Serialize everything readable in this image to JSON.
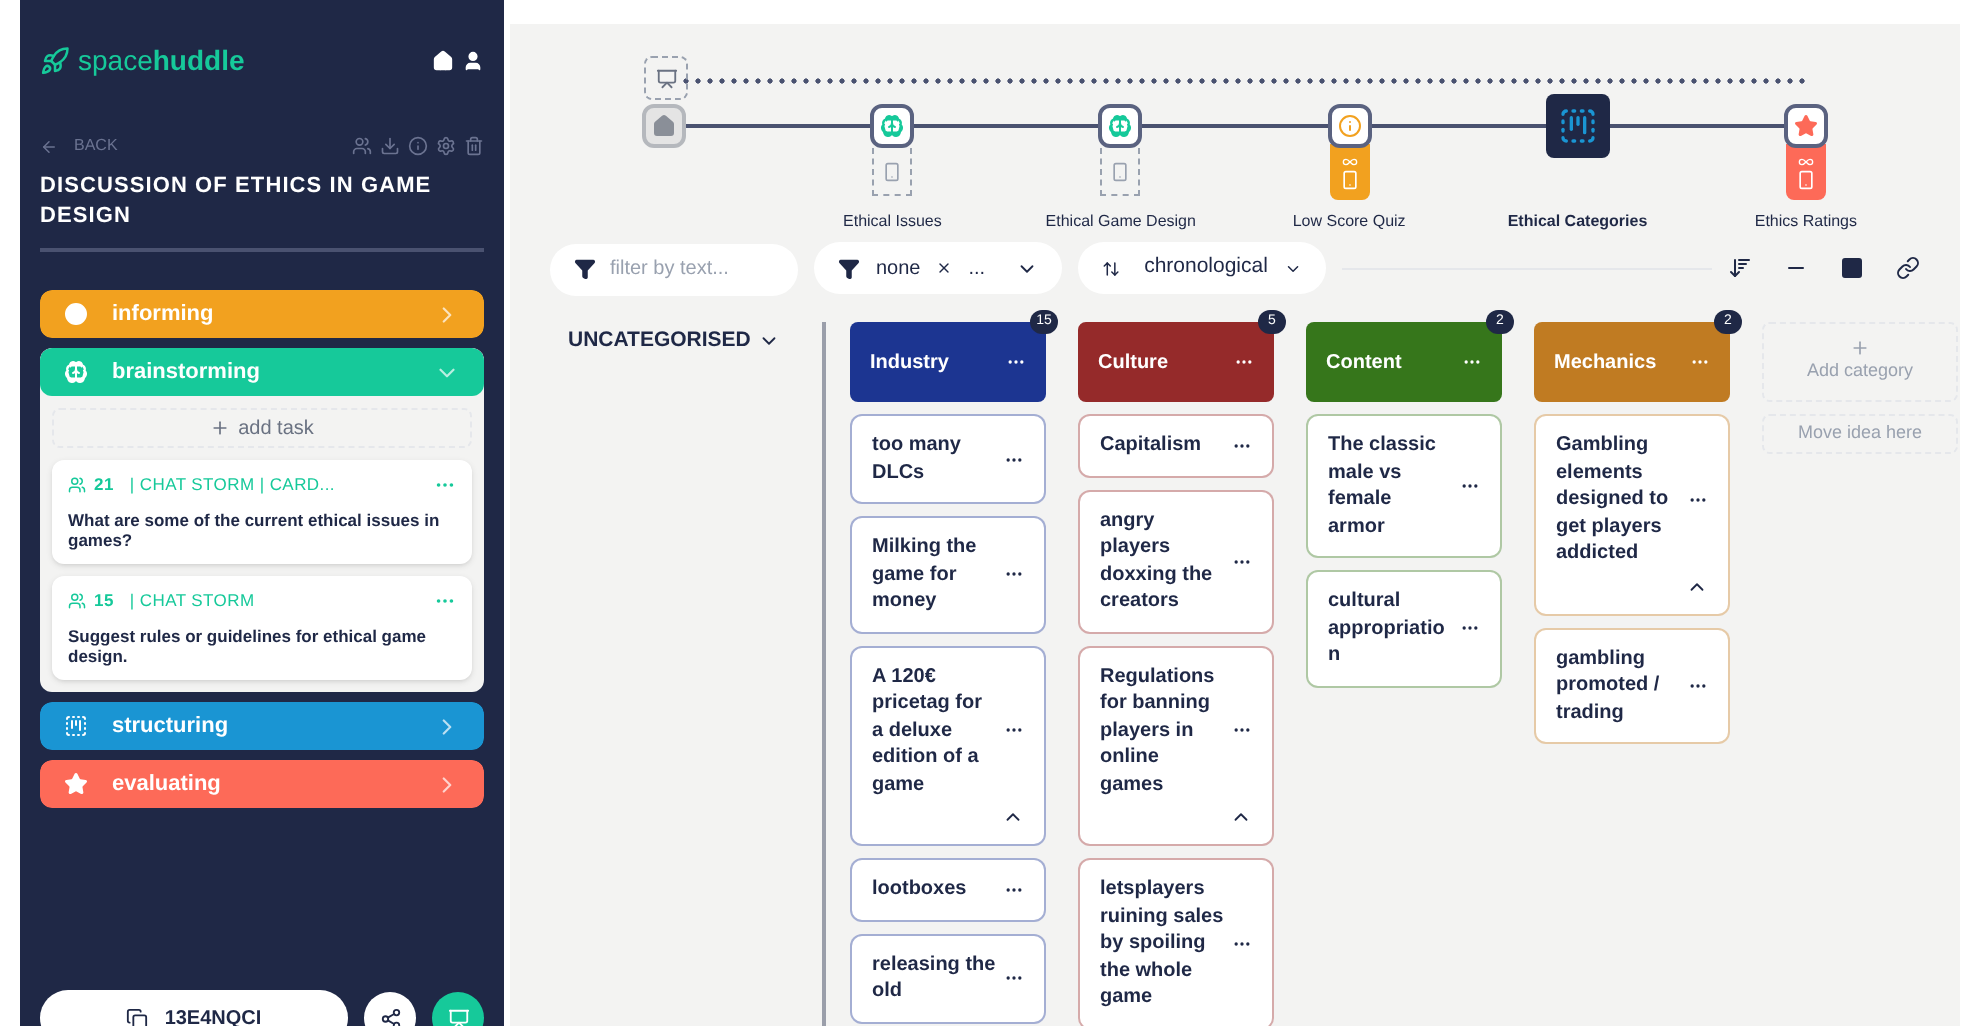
{
  "sidebar": {
    "logo": {
      "light": "space",
      "bold": "huddle"
    },
    "back": "BACK",
    "session_title": "DISCUSSION OF ETHICS IN GAME DESIGN",
    "phases": [
      {
        "kind": "info",
        "label": "informing",
        "color": "#f2a11f",
        "expanded": false
      },
      {
        "kind": "brainstorm",
        "label": "brainstorming",
        "color": "#16c99a",
        "expanded": true,
        "add_task": "add task",
        "tasks": [
          {
            "participants": "21",
            "meta": "| CHAT STORM | CARD...",
            "question": "What are some of the current ethical issues in games?"
          },
          {
            "participants": "15",
            "meta": "| CHAT STORM",
            "question": "Suggest rules or guidelines for ethical game design."
          }
        ]
      },
      {
        "kind": "structure",
        "label": "structuring",
        "color": "#1a95d3",
        "expanded": false
      },
      {
        "kind": "rating",
        "label": "evaluating",
        "color": "#fd6a58",
        "expanded": false
      }
    ],
    "session_code": "13E4NQCI"
  },
  "timeline": [
    {
      "kind": "home",
      "selected": false
    },
    {
      "kind": "brainstorm",
      "label": "Ethical Issues",
      "selected": false,
      "module": {
        "kind": "dashed"
      }
    },
    {
      "kind": "brainstorm",
      "label": "Ethical Game Design",
      "selected": false,
      "module": {
        "kind": "dashed"
      }
    },
    {
      "kind": "info",
      "label": "Low Score Quiz",
      "selected": false,
      "module": {
        "kind": "active"
      }
    },
    {
      "kind": "structure",
      "label": "Ethical Categories",
      "selected": true
    },
    {
      "kind": "rating",
      "label": "Ethics Ratings",
      "selected": false,
      "module": {
        "kind": "active"
      }
    }
  ],
  "filters": {
    "text_placeholder": "filter by text...",
    "category": "none",
    "category_more": "...",
    "order": "chronological"
  },
  "uncategorised": "UNCATEGORISED",
  "categories": [
    {
      "name": "Industry",
      "count": "15",
      "color": "#1c3591",
      "ideas": [
        {
          "text": "too many DLCs",
          "expanded": false
        },
        {
          "text": "Milking the game for money",
          "expanded": false
        },
        {
          "text": "A 120€ pricetag for a deluxe edition of a game",
          "expanded": true
        },
        {
          "text": "lootboxes",
          "expanded": false
        },
        {
          "text": "releasing the old",
          "expanded": false
        }
      ]
    },
    {
      "name": "Culture",
      "count": "5",
      "color": "#952a2a",
      "ideas": [
        {
          "text": "Capitalism",
          "expanded": false
        },
        {
          "text": "angry players doxxing the creators",
          "expanded": false
        },
        {
          "text": "Regulations for banning players in online games",
          "expanded": true
        },
        {
          "text": "letsplayers ruining sales by spoiling the whole game",
          "expanded": false
        }
      ]
    },
    {
      "name": "Content",
      "count": "2",
      "color": "#36761b",
      "ideas": [
        {
          "text": "The classic male vs female armor",
          "expanded": false
        },
        {
          "text": "cultural appropriatio n",
          "expanded": false
        }
      ]
    },
    {
      "name": "Mechanics",
      "count": "2",
      "color": "#c07b22",
      "ideas": [
        {
          "text": "Gambling elements designed to get players addicted",
          "expanded": true
        },
        {
          "text": "gambling promoted / trading",
          "expanded": false
        }
      ]
    }
  ],
  "add_category": "Add category",
  "move_idea": "Move idea here"
}
